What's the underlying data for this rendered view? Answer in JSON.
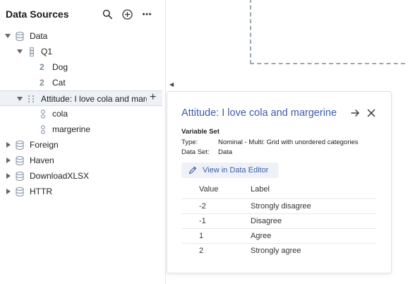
{
  "panel": {
    "title": "Data Sources",
    "icons": [
      "search-icon",
      "add-circle-icon",
      "more-icon"
    ]
  },
  "tree": {
    "data": "Data",
    "q1": "Q1",
    "dog": "Dog",
    "cat": "Cat",
    "num_glyph": "2",
    "attitude": "Attitude: I love cola and margerine",
    "add": "+",
    "cola": "cola",
    "margerine": "margerine",
    "foreign": "Foreign",
    "haven": "Haven",
    "downloadxlsx": "DownloadXLSX",
    "httr": "HTTR"
  },
  "collapse_glyph": "◀",
  "popover": {
    "title": "Attitude: I love cola and margerine",
    "section": "Variable Set",
    "type_label": "Type:",
    "type_value": "Nominal - Multi: Grid with unordered categories",
    "dataset_label": "Data Set:",
    "dataset_value": "Data",
    "view_button": "View in Data Editor",
    "table": {
      "headers": [
        "Value",
        "Label"
      ],
      "rows": [
        {
          "value": "-2",
          "label": "Strongly disagree"
        },
        {
          "value": "-1",
          "label": "Disagree"
        },
        {
          "value": "1",
          "label": "Agree"
        },
        {
          "value": "2",
          "label": "Strongly agree"
        }
      ]
    }
  },
  "colors": {
    "accent": "#3b5ba9",
    "selected_bg": "#eef2f7",
    "dashed": "#9aa6b5"
  }
}
